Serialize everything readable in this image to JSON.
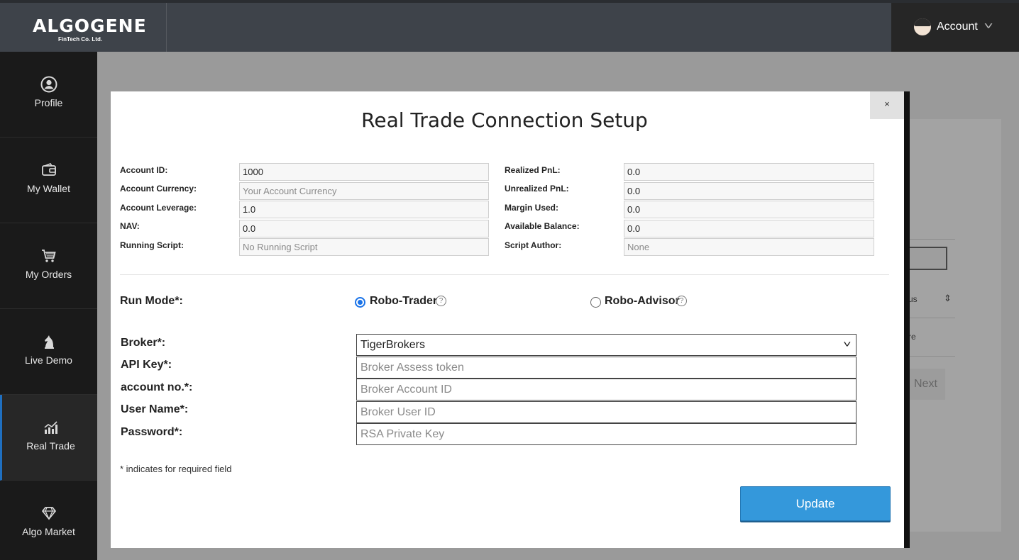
{
  "header": {
    "logo_main": "ALGOGENE",
    "logo_sub": "FinTech Co. Ltd.",
    "account_label": "Account"
  },
  "sidebar": {
    "items": [
      {
        "label": "Profile",
        "icon": "user-circle-icon"
      },
      {
        "label": "My Wallet",
        "icon": "wallet-icon"
      },
      {
        "label": "My Orders",
        "icon": "cart-icon"
      },
      {
        "label": "Live Demo",
        "icon": "chess-knight-icon"
      },
      {
        "label": "Real Trade",
        "icon": "chart-bar-icon"
      },
      {
        "label": "Algo Market",
        "icon": "diamond-icon"
      }
    ],
    "active": "Real Trade"
  },
  "background": {
    "sort_fragment": "us",
    "row_fragment": "re",
    "next_label": "Next"
  },
  "modal": {
    "title": "Real Trade Connection Setup",
    "close_label": "×",
    "left_fields": [
      {
        "label": "Account ID:",
        "value": "1000",
        "placeholder": ""
      },
      {
        "label": "Account Currency:",
        "value": "",
        "placeholder": "Your Account Currency"
      },
      {
        "label": "Account Leverage:",
        "value": "1.0",
        "placeholder": ""
      },
      {
        "label": "NAV:",
        "value": "0.0",
        "placeholder": ""
      },
      {
        "label": "Running Script:",
        "value": "",
        "placeholder": "No Running Script"
      }
    ],
    "right_fields": [
      {
        "label": "Realized PnL:",
        "value": "0.0",
        "placeholder": ""
      },
      {
        "label": "Unrealized PnL:",
        "value": "0.0",
        "placeholder": ""
      },
      {
        "label": "Margin Used:",
        "value": "0.0",
        "placeholder": ""
      },
      {
        "label": "Available Balance:",
        "value": "0.0",
        "placeholder": ""
      },
      {
        "label": "Script Author:",
        "value": "",
        "placeholder": "None"
      }
    ],
    "run_mode": {
      "label": "Run Mode*:",
      "options": [
        "Robo-Trader",
        "Robo-Advisor"
      ],
      "selected": "Robo-Trader"
    },
    "broker": {
      "label": "Broker*:",
      "selected": "TigerBrokers"
    },
    "inputs": [
      {
        "label": "API Key*:",
        "placeholder": "Broker Assess token"
      },
      {
        "label": "account no.*:",
        "placeholder": "Broker Account ID"
      },
      {
        "label": "User Name*:",
        "placeholder": "Broker User ID"
      },
      {
        "label": "Password*:",
        "placeholder": "RSA Private Key"
      }
    ],
    "required_note": "* indicates for required field",
    "update_label": "Update"
  }
}
